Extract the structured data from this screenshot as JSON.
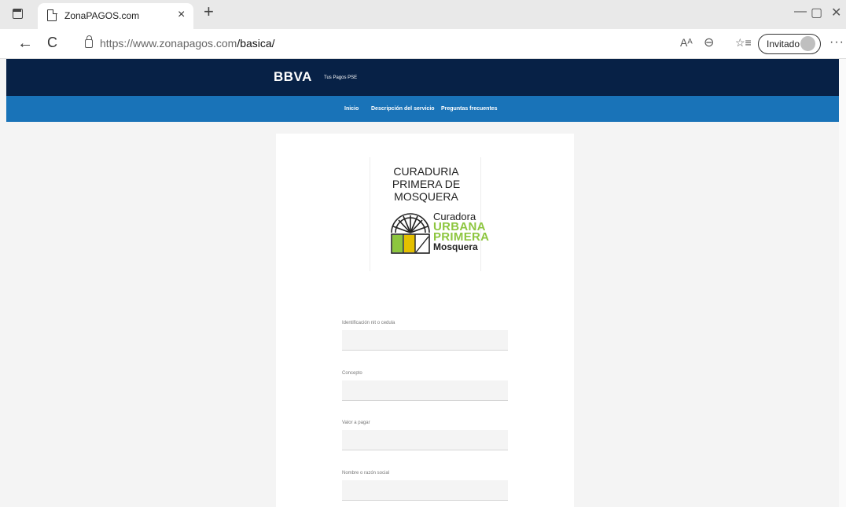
{
  "browser": {
    "tab_title": "ZonaPAGOS.com",
    "tab_close": "×",
    "new_tab": "+",
    "url_host": "https://www.zonapagos.com",
    "url_path": "/basica/",
    "profile_label": "Invitado",
    "minimize": "—",
    "restore": "▢",
    "close": "✕",
    "back": "←",
    "reload": "C",
    "read_aloud": "Aᴬ",
    "zoom": "⊖",
    "favorites": "☆≡",
    "more": "···"
  },
  "site": {
    "brand": "BBVA",
    "brand_sub": "Tus Pagos PSE",
    "nav": [
      {
        "label": "Inicio"
      },
      {
        "label": "Descripción del servicio"
      },
      {
        "label": "Preguntas frecuentes"
      }
    ]
  },
  "merchant": {
    "title_line1": "CURADURIA",
    "title_line2": "PRIMERA DE",
    "title_line3": "MOSQUERA",
    "logo_word1": "Curadora",
    "logo_word2": "URBANA",
    "logo_word3": "PRIMERA",
    "logo_word4": "Mosquera",
    "colors": {
      "green": "#8dc63f",
      "yellow": "#e4c000",
      "dark": "#222222"
    }
  },
  "form": {
    "fields": [
      {
        "label": "Identificación nit o cedula",
        "value": ""
      },
      {
        "label": "Concepto",
        "value": ""
      },
      {
        "label": "Valor a pagar",
        "value": ""
      },
      {
        "label": "Nombre o razón social",
        "value": ""
      }
    ]
  },
  "colors": {
    "header_dark": "#072146",
    "header_nav": "#1973b8"
  }
}
